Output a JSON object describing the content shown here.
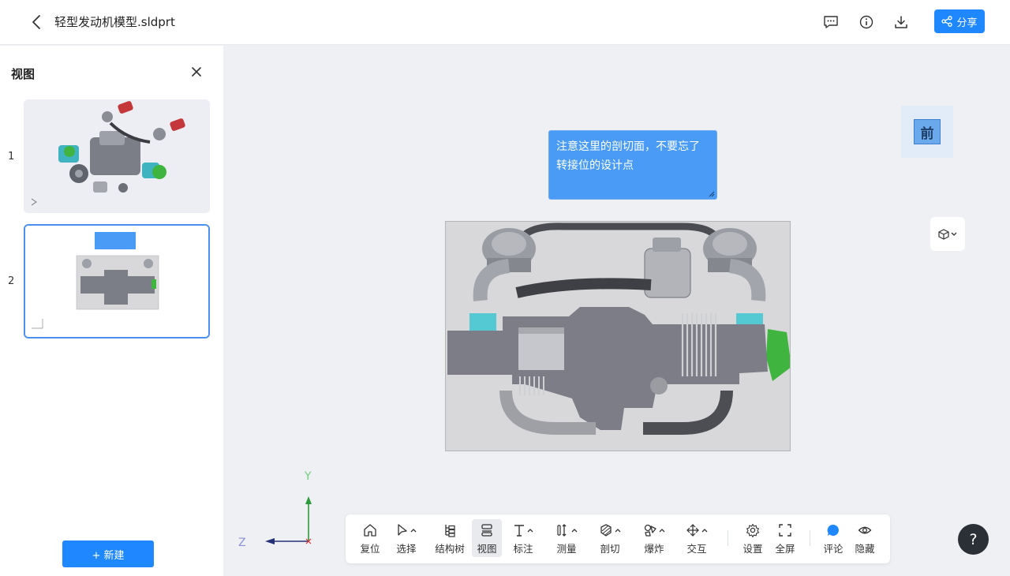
{
  "header": {
    "file_name": "轻型发动机模型.sldprt",
    "share_label": "分享",
    "icons": [
      "back-arrow-icon",
      "comment-list-icon",
      "info-icon",
      "download-icon",
      "share-icon"
    ]
  },
  "left_panel": {
    "title": "视图",
    "views": [
      {
        "number": "1",
        "active": false
      },
      {
        "number": "2",
        "active": true,
        "note": "注意这里的剖切面，不要忘了转接位的设计点"
      }
    ],
    "new_label": "+ 新建"
  },
  "viewport": {
    "comment_text": "注意这里的剖切面，不要忘了转接位的设计点",
    "view_cube_face": "前",
    "axis": {
      "x": "",
      "y": "Y",
      "z": "Z"
    }
  },
  "toolbar": {
    "items": [
      {
        "label": "复位",
        "icon": "home-icon",
        "has_caret": false,
        "active": false
      },
      {
        "label": "选择",
        "icon": "cursor-icon",
        "has_caret": true,
        "active": false
      },
      {
        "label": "结构树",
        "icon": "tree-icon",
        "has_caret": false,
        "active": false
      },
      {
        "label": "视图",
        "icon": "view-icon",
        "has_caret": false,
        "active": true
      },
      {
        "label": "标注",
        "icon": "text-annotation-icon",
        "has_caret": true,
        "active": false
      },
      {
        "label": "测量",
        "icon": "measure-icon",
        "has_caret": true,
        "active": false
      },
      {
        "label": "剖切",
        "icon": "section-icon",
        "has_caret": true,
        "active": false
      },
      {
        "label": "爆炸",
        "icon": "explode-icon",
        "has_caret": true,
        "active": false
      },
      {
        "label": "交互",
        "icon": "interact-icon",
        "has_caret": true,
        "active": false
      },
      {
        "label": "设置",
        "icon": "gear-icon",
        "has_caret": false,
        "active": false
      },
      {
        "label": "全屏",
        "icon": "fullscreen-icon",
        "has_caret": false,
        "active": false
      },
      {
        "label": "评论",
        "icon": "comment-icon",
        "has_caret": false,
        "active": false
      },
      {
        "label": "隐藏",
        "icon": "eye-icon",
        "has_caret": false,
        "active": false
      }
    ]
  },
  "help_label": "?",
  "colors": {
    "accent": "#1f87ff",
    "comment_bg": "#4a9bf5",
    "help_bg": "#2b2f36"
  }
}
